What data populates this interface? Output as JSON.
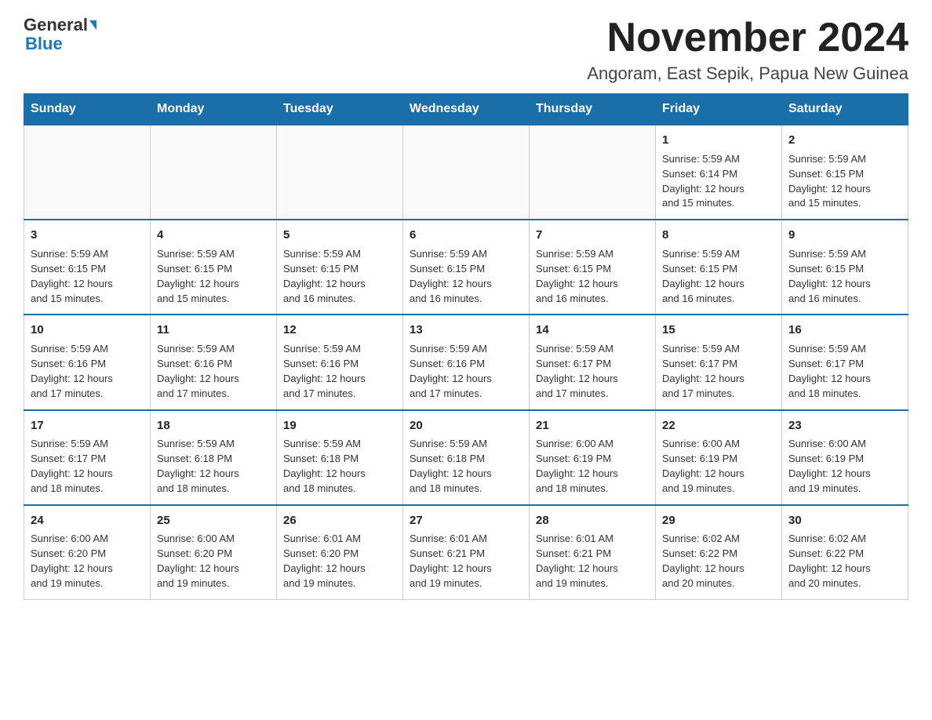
{
  "header": {
    "logo_general": "General",
    "logo_blue": "Blue",
    "month_title": "November 2024",
    "location": "Angoram, East Sepik, Papua New Guinea"
  },
  "calendar": {
    "days_of_week": [
      "Sunday",
      "Monday",
      "Tuesday",
      "Wednesday",
      "Thursday",
      "Friday",
      "Saturday"
    ],
    "weeks": [
      [
        {
          "day": "",
          "info": ""
        },
        {
          "day": "",
          "info": ""
        },
        {
          "day": "",
          "info": ""
        },
        {
          "day": "",
          "info": ""
        },
        {
          "day": "",
          "info": ""
        },
        {
          "day": "1",
          "info": "Sunrise: 5:59 AM\nSunset: 6:14 PM\nDaylight: 12 hours\nand 15 minutes."
        },
        {
          "day": "2",
          "info": "Sunrise: 5:59 AM\nSunset: 6:15 PM\nDaylight: 12 hours\nand 15 minutes."
        }
      ],
      [
        {
          "day": "3",
          "info": "Sunrise: 5:59 AM\nSunset: 6:15 PM\nDaylight: 12 hours\nand 15 minutes."
        },
        {
          "day": "4",
          "info": "Sunrise: 5:59 AM\nSunset: 6:15 PM\nDaylight: 12 hours\nand 15 minutes."
        },
        {
          "day": "5",
          "info": "Sunrise: 5:59 AM\nSunset: 6:15 PM\nDaylight: 12 hours\nand 16 minutes."
        },
        {
          "day": "6",
          "info": "Sunrise: 5:59 AM\nSunset: 6:15 PM\nDaylight: 12 hours\nand 16 minutes."
        },
        {
          "day": "7",
          "info": "Sunrise: 5:59 AM\nSunset: 6:15 PM\nDaylight: 12 hours\nand 16 minutes."
        },
        {
          "day": "8",
          "info": "Sunrise: 5:59 AM\nSunset: 6:15 PM\nDaylight: 12 hours\nand 16 minutes."
        },
        {
          "day": "9",
          "info": "Sunrise: 5:59 AM\nSunset: 6:15 PM\nDaylight: 12 hours\nand 16 minutes."
        }
      ],
      [
        {
          "day": "10",
          "info": "Sunrise: 5:59 AM\nSunset: 6:16 PM\nDaylight: 12 hours\nand 17 minutes."
        },
        {
          "day": "11",
          "info": "Sunrise: 5:59 AM\nSunset: 6:16 PM\nDaylight: 12 hours\nand 17 minutes."
        },
        {
          "day": "12",
          "info": "Sunrise: 5:59 AM\nSunset: 6:16 PM\nDaylight: 12 hours\nand 17 minutes."
        },
        {
          "day": "13",
          "info": "Sunrise: 5:59 AM\nSunset: 6:16 PM\nDaylight: 12 hours\nand 17 minutes."
        },
        {
          "day": "14",
          "info": "Sunrise: 5:59 AM\nSunset: 6:17 PM\nDaylight: 12 hours\nand 17 minutes."
        },
        {
          "day": "15",
          "info": "Sunrise: 5:59 AM\nSunset: 6:17 PM\nDaylight: 12 hours\nand 17 minutes."
        },
        {
          "day": "16",
          "info": "Sunrise: 5:59 AM\nSunset: 6:17 PM\nDaylight: 12 hours\nand 18 minutes."
        }
      ],
      [
        {
          "day": "17",
          "info": "Sunrise: 5:59 AM\nSunset: 6:17 PM\nDaylight: 12 hours\nand 18 minutes."
        },
        {
          "day": "18",
          "info": "Sunrise: 5:59 AM\nSunset: 6:18 PM\nDaylight: 12 hours\nand 18 minutes."
        },
        {
          "day": "19",
          "info": "Sunrise: 5:59 AM\nSunset: 6:18 PM\nDaylight: 12 hours\nand 18 minutes."
        },
        {
          "day": "20",
          "info": "Sunrise: 5:59 AM\nSunset: 6:18 PM\nDaylight: 12 hours\nand 18 minutes."
        },
        {
          "day": "21",
          "info": "Sunrise: 6:00 AM\nSunset: 6:19 PM\nDaylight: 12 hours\nand 18 minutes."
        },
        {
          "day": "22",
          "info": "Sunrise: 6:00 AM\nSunset: 6:19 PM\nDaylight: 12 hours\nand 19 minutes."
        },
        {
          "day": "23",
          "info": "Sunrise: 6:00 AM\nSunset: 6:19 PM\nDaylight: 12 hours\nand 19 minutes."
        }
      ],
      [
        {
          "day": "24",
          "info": "Sunrise: 6:00 AM\nSunset: 6:20 PM\nDaylight: 12 hours\nand 19 minutes."
        },
        {
          "day": "25",
          "info": "Sunrise: 6:00 AM\nSunset: 6:20 PM\nDaylight: 12 hours\nand 19 minutes."
        },
        {
          "day": "26",
          "info": "Sunrise: 6:01 AM\nSunset: 6:20 PM\nDaylight: 12 hours\nand 19 minutes."
        },
        {
          "day": "27",
          "info": "Sunrise: 6:01 AM\nSunset: 6:21 PM\nDaylight: 12 hours\nand 19 minutes."
        },
        {
          "day": "28",
          "info": "Sunrise: 6:01 AM\nSunset: 6:21 PM\nDaylight: 12 hours\nand 19 minutes."
        },
        {
          "day": "29",
          "info": "Sunrise: 6:02 AM\nSunset: 6:22 PM\nDaylight: 12 hours\nand 20 minutes."
        },
        {
          "day": "30",
          "info": "Sunrise: 6:02 AM\nSunset: 6:22 PM\nDaylight: 12 hours\nand 20 minutes."
        }
      ]
    ]
  }
}
